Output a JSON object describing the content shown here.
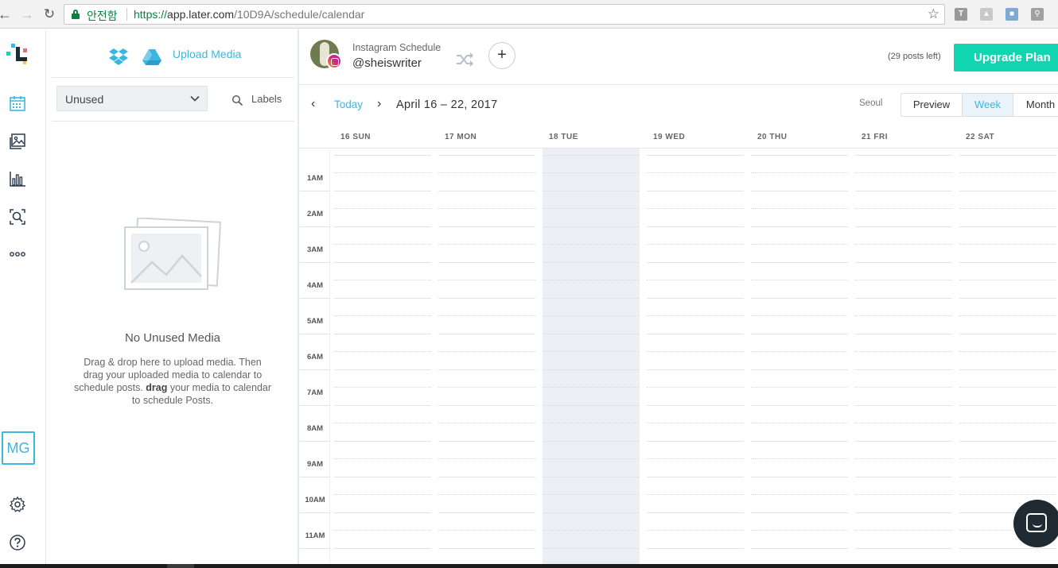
{
  "browser": {
    "secure_label": "안전함",
    "url_scheme": "https://",
    "url_host": "app.later.com",
    "url_path": "/10D9A/schedule/calendar"
  },
  "sidebar": {
    "items": [
      {
        "name": "calendar",
        "icon": "calendar-icon"
      },
      {
        "name": "media-library",
        "icon": "media-icon"
      },
      {
        "name": "analytics",
        "icon": "bar-chart-icon"
      },
      {
        "name": "search",
        "icon": "search-icon"
      },
      {
        "name": "more",
        "icon": "more-icon"
      }
    ],
    "user_initials": "MG",
    "settings_icon": "gear-icon",
    "help_icon": "help-icon"
  },
  "media_panel": {
    "upload_label": "Upload Media",
    "filter_value": "Unused",
    "labels_button": "Labels",
    "empty_title": "No Unused Media",
    "empty_desc_1": "Drag & drop here to upload media. Then drag your uploaded media to calendar to schedule posts. ",
    "empty_desc_bold": "drag",
    "empty_desc_2": " your media to calendar to schedule Posts."
  },
  "header": {
    "profile_label": "Instagram Schedule",
    "profile_handle": "@sheiswriter",
    "posts_left": "(29 posts left)",
    "upgrade_label": "Upgrade Plan",
    "accent_color": "#10d5b0"
  },
  "toolbar": {
    "today_label": "Today",
    "date_range": "April 16 – 22, 2017",
    "timezone": "Seoul",
    "views": {
      "preview": "Preview",
      "week": "Week",
      "month": "Month"
    },
    "active_view": "Week"
  },
  "calendar": {
    "days": [
      "16 SUN",
      "17 MON",
      "18 TUE",
      "19 WED",
      "20 THU",
      "21 FRI",
      "22 SAT"
    ],
    "today_index": 2,
    "hours": [
      "1AM",
      "2AM",
      "3AM",
      "4AM",
      "5AM",
      "6AM",
      "7AM",
      "8AM",
      "9AM",
      "10AM",
      "11AM"
    ]
  }
}
